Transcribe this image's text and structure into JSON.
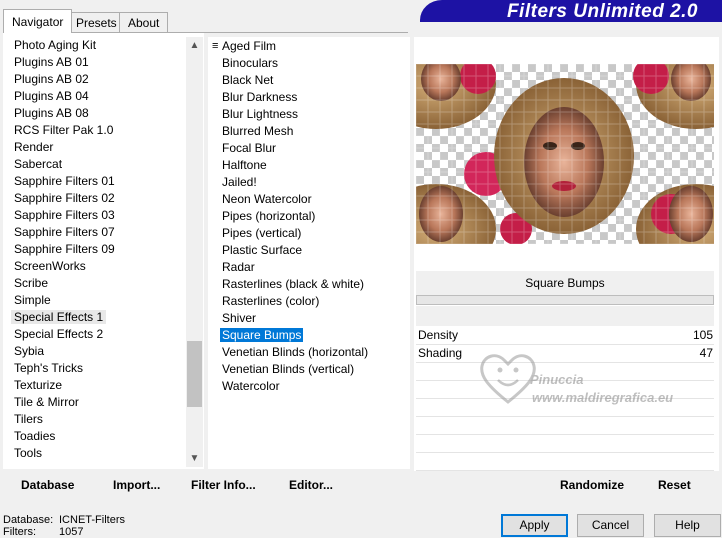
{
  "tabs": [
    "Navigator",
    "Presets",
    "About"
  ],
  "banner_title": "Filters Unlimited 2.0",
  "categories": [
    "Photo Aging Kit",
    "Plugins AB 01",
    "Plugins AB 02",
    "Plugins AB 04",
    "Plugins AB 08",
    "RCS Filter Pak 1.0",
    "Render",
    "Sabercat",
    "Sapphire Filters 01",
    "Sapphire Filters 02",
    "Sapphire Filters 03",
    "Sapphire Filters 07",
    "Sapphire Filters 09",
    "ScreenWorks",
    "Scribe",
    "Simple",
    "Special Effects 1",
    "Special Effects 2",
    "Sybia",
    "Teph's Tricks",
    "Texturize",
    "Tile & Mirror",
    "Tilers",
    "Toadies",
    "Tools"
  ],
  "selected_category": "Special Effects 1",
  "filters": [
    "Aged Film",
    "Binoculars",
    "Black Net",
    "Blur Darkness",
    "Blur Lightness",
    "Blurred Mesh",
    "Focal Blur",
    "Halftone",
    "Jailed!",
    "Neon Watercolor",
    "Pipes (horizontal)",
    "Pipes (vertical)",
    "Plastic Surface",
    "Radar",
    "Rasterlines (black & white)",
    "Rasterlines (color)",
    "Shiver",
    "Square Bumps",
    "Venetian Blinds (horizontal)",
    "Venetian Blinds (vertical)",
    "Watercolor"
  ],
  "selected_filter": "Square Bumps",
  "filter_name": "Square Bumps",
  "params": [
    {
      "label": "Density",
      "value": "105"
    },
    {
      "label": "Shading",
      "value": "47"
    }
  ],
  "watermark": {
    "line1": "Pinuccia",
    "line2": "www.maldiregrafica.eu"
  },
  "toolbar": {
    "database": "Database",
    "import": "Import...",
    "filter_info": "Filter Info...",
    "editor": "Editor...",
    "randomize": "Randomize",
    "reset": "Reset"
  },
  "status": {
    "database_label": "Database:",
    "database_value": "ICNET-Filters",
    "filters_label": "Filters:",
    "filters_value": "1057"
  },
  "buttons": {
    "apply": "Apply",
    "cancel": "Cancel",
    "help": "Help"
  },
  "colors": {
    "banner": "#1d12a4",
    "selection": "#0078d7"
  }
}
